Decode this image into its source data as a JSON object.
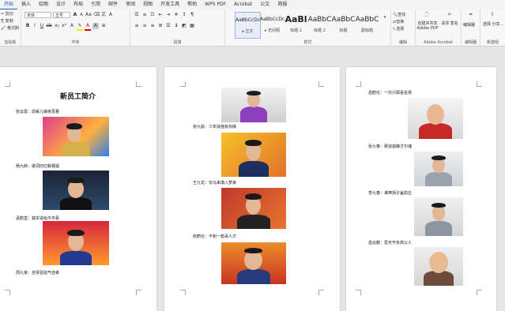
{
  "ribbon_tabs": [
    "开始",
    "插入",
    "绘图",
    "设计",
    "布局",
    "引用",
    "邮件",
    "审阅",
    "视图",
    "开发工具",
    "帮助",
    "WPS PDF",
    "Acrobat",
    "公文",
    "简报"
  ],
  "ribbon": {
    "clipboard": {
      "cut": "剪切",
      "copy": "复制",
      "format_painter": "格式刷",
      "group_label": "剪贴板"
    },
    "font": {
      "font_name": "宋体",
      "font_size": "五号",
      "grow": "A",
      "shrink": "A",
      "aa": "Aa",
      "group_label": "字体"
    },
    "paragraph": {
      "group_label": "段落"
    },
    "styles": {
      "items": [
        {
          "sample": "AaBbCcDc",
          "name": "▸ 正文"
        },
        {
          "sample": "AaBbCcDc",
          "name": "▸ 无间隔"
        },
        {
          "sample": "AaBl",
          "name": "标题 1"
        },
        {
          "sample": "AaBbC",
          "name": "标题 2"
        },
        {
          "sample": "AaBbC",
          "name": "标题"
        },
        {
          "sample": "AaBbC",
          "name": "副标题"
        }
      ],
      "group_label": "样式"
    },
    "editing": {
      "find": "查找",
      "replace": "替换",
      "select": "选择",
      "group_label": "编辑"
    },
    "acrobat": {
      "create_share": "创建并共享 Adobe PDF",
      "request_sign": "请求 签名",
      "group_label": "Adobe Acrobat"
    },
    "editor": {
      "label": "编辑器",
      "group_label": "编辑器"
    },
    "new_group": {
      "label": "选择 分享...",
      "group_label": "新建组"
    }
  },
  "page1": {
    "title": "新员工简介",
    "items": [
      "张云雷：前辈儿娘亲思量",
      "杨九郎：歌词旧忆躲钢遁",
      "孟鹤堂：其实说给今日看",
      "周九良：自琴弦弦气自卑"
    ]
  },
  "page2": {
    "items": [
      "张九龄：少年扶摇有剑缘",
      "王九龙：仅马来填入梦来",
      "张鹤伦：不和一稳哥人才"
    ]
  },
  "page3": {
    "items": [
      "岳鹤伦：一次只顾喜名扬",
      "张九泰：那道孤峰才尔魂",
      "李九春：谁捧拐子盖如丘",
      "岳云鹏：爱天不负高公人"
    ]
  },
  "colors": {
    "accent": "#185abd",
    "page_bg": "#ffffff",
    "workspace": "#e6e6e6"
  }
}
